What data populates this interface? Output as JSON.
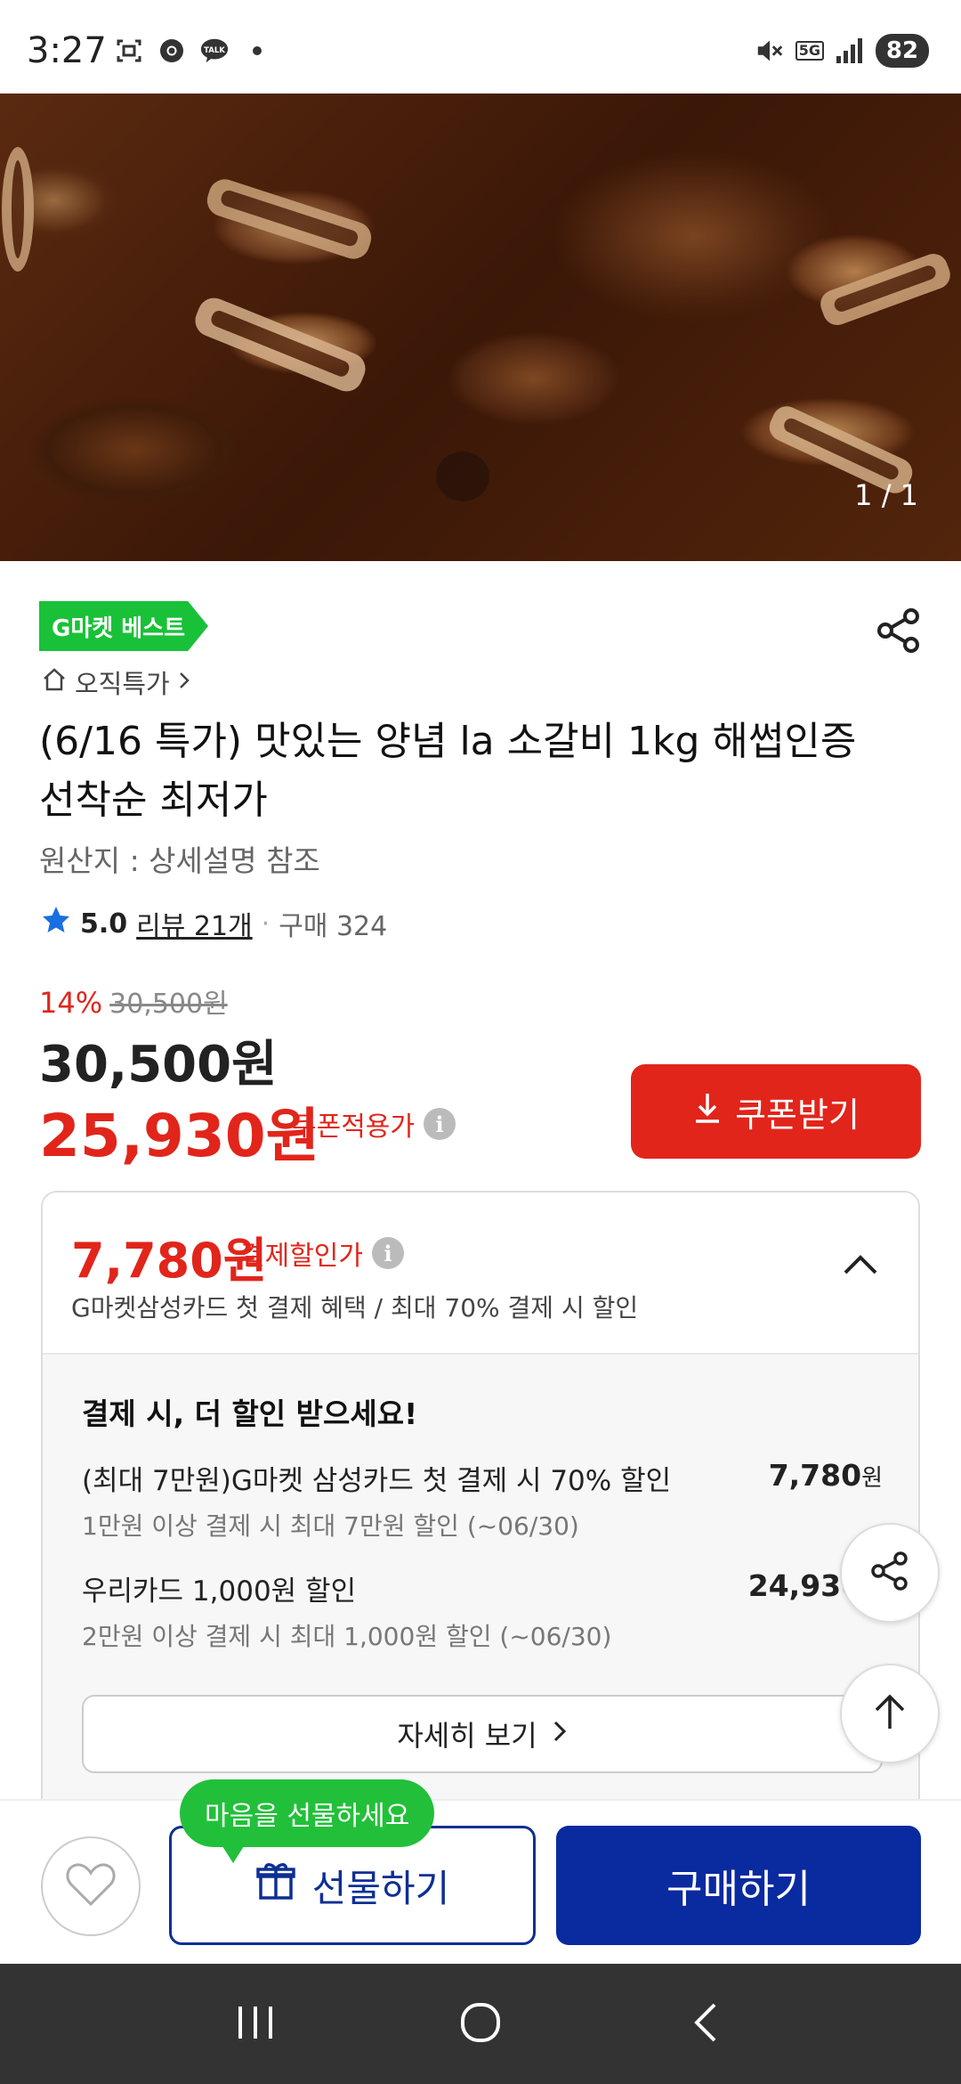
{
  "status_bar": {
    "time": "3:27",
    "network": "5G",
    "battery": "82"
  },
  "hero": {
    "image_counter": "1 / 1"
  },
  "product": {
    "badge": "G마켓 베스트",
    "breadcrumb": "오직특가",
    "title": "(6/16 특가) 맛있는 양념 la 소갈비 1kg 해썹인증 선착순 최저가",
    "origin": "원산지 : 상세설명 참조",
    "rating": "5.0",
    "rating_value": 5.0,
    "review_link": "리뷰 21개",
    "dot": "·",
    "purchase_count": "구매 324"
  },
  "pricing": {
    "discount_pct": "14%",
    "original_price": "30,500원",
    "sale_price": "30,500원",
    "coupon_price": "25,930원",
    "coupon_label": "쿠폰적용가",
    "coupon_button": "쿠폰받기"
  },
  "payment_card": {
    "price": "7,780원",
    "label": "결제할인가",
    "description": "G마켓삼성카드 첫 결제 혜택 / 최대 70% 결제 시 할인",
    "body_title": "결제 시, 더 할인 받으세요!",
    "offers": [
      {
        "name": "(최대 7만원)G마켓 삼성카드 첫 결제 시 70% 할인",
        "sub": "1만원 이상 결제 시 최대 7만원 할인 (~06/30)",
        "value": "7,780",
        "unit": "원"
      },
      {
        "name": "우리카드 1,000원 할인",
        "sub": "2만원 이상 결제 시 최대 1,000원 할인 (~06/30)",
        "value": "24,930",
        "unit": "원"
      }
    ],
    "detail_button": "자세히 보기"
  },
  "bottom_bar": {
    "gift_bubble": "마음을 선물하세요",
    "gift_button": "선물하기",
    "buy_button": "구매하기"
  },
  "colors": {
    "accent_red": "#e1251b",
    "brand_blue": "#0a2aa0",
    "best_green": "#19c138"
  }
}
